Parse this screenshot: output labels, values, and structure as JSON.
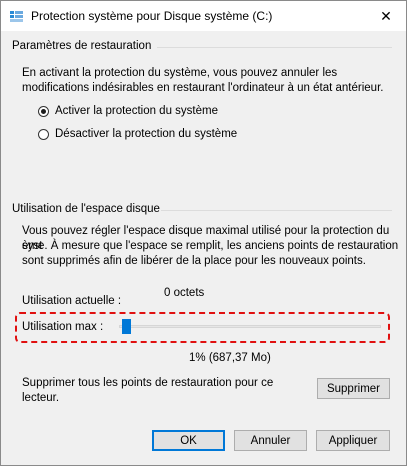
{
  "window": {
    "title": "Protection système pour Disque système (C:)",
    "close_glyph": "✕"
  },
  "restore_settings": {
    "group_title": "Paramètres de restauration",
    "description_line1": "En activant la protection du système, vous pouvez annuler les",
    "description_line2": "modifications indésirables en restaurant l'ordinateur à un état antérieur.",
    "options": [
      {
        "label": "Activer la protection du système",
        "checked": true
      },
      {
        "label": "Désactiver la protection du système",
        "checked": false
      }
    ]
  },
  "disk_usage": {
    "group_title": "Utilisation de l'espace disque",
    "description_line1": "Vous pouvez régler l'espace disque maximal utilisé pour la protection du syst",
    "description_line2": "ème. À mesure que l'espace se remplit, les anciens points de restauration",
    "description_line3": "sont supprimés afin de libérer de la place pour les nouveaux points.",
    "current_usage_label": "Utilisation actuelle :",
    "current_usage_value": "0 octets",
    "max_usage_label": "Utilisation max :",
    "max_usage_percent": 1,
    "max_usage_value_text": "1% (687,37 Mo)",
    "delete_text_line1": "Supprimer tous les points de restauration pour ce",
    "delete_text_line2": "lecteur.",
    "delete_button": "Supprimer"
  },
  "footer": {
    "ok": "OK",
    "cancel": "Annuler",
    "apply": "Appliquer"
  },
  "colors": {
    "accent": "#0078d7",
    "highlight": "#e01010",
    "client_bg": "#f0f0f0"
  },
  "icons": {
    "title": "system-protection-icon",
    "close": "close-icon"
  }
}
